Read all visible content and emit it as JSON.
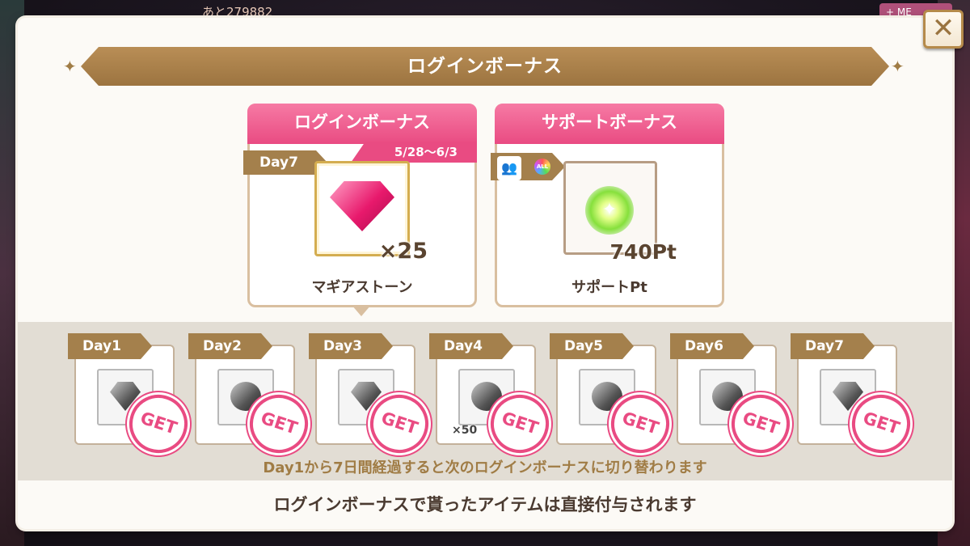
{
  "background": {
    "counter_text": "あと279882",
    "top_right_label": "+ ME"
  },
  "modal": {
    "title": "ログインボーナス",
    "close_glyph": "✕",
    "login_card": {
      "header": "ログインボーナス",
      "date_range": "5/28〜6/3",
      "day": "Day7",
      "item_icon": "pink-gem-icon",
      "quantity": "×25",
      "item_name": "マギアストーン"
    },
    "support_card": {
      "header": "サポートボーナス",
      "item_icon": "green-orb-icon",
      "quantity": "740Pt",
      "item_name": "サポートPt"
    },
    "days": [
      {
        "label": "Day1",
        "icon": "gray-gem-icon",
        "status": "GET"
      },
      {
        "label": "Day2",
        "icon": "gray-orb-icon",
        "status": "GET"
      },
      {
        "label": "Day3",
        "icon": "gray-gem-icon",
        "status": "GET"
      },
      {
        "label": "Day4",
        "icon": "coin-icon",
        "quantity": "×50",
        "status": "GET"
      },
      {
        "label": "Day5",
        "icon": "silver-coin-icon",
        "status": "GET"
      },
      {
        "label": "Day6",
        "icon": "gray-ornament-icon",
        "status": "GET"
      },
      {
        "label": "Day7",
        "icon": "gray-gem-icon",
        "status": "GET"
      }
    ],
    "strip_note": "Day1から7日間経過すると次のログインボーナスに切り替わります",
    "footer_note": "ログインボーナスで貰ったアイテムは直接付与されます"
  },
  "colors": {
    "accent_pink": "#e94b82",
    "accent_gold": "#a4804c"
  }
}
